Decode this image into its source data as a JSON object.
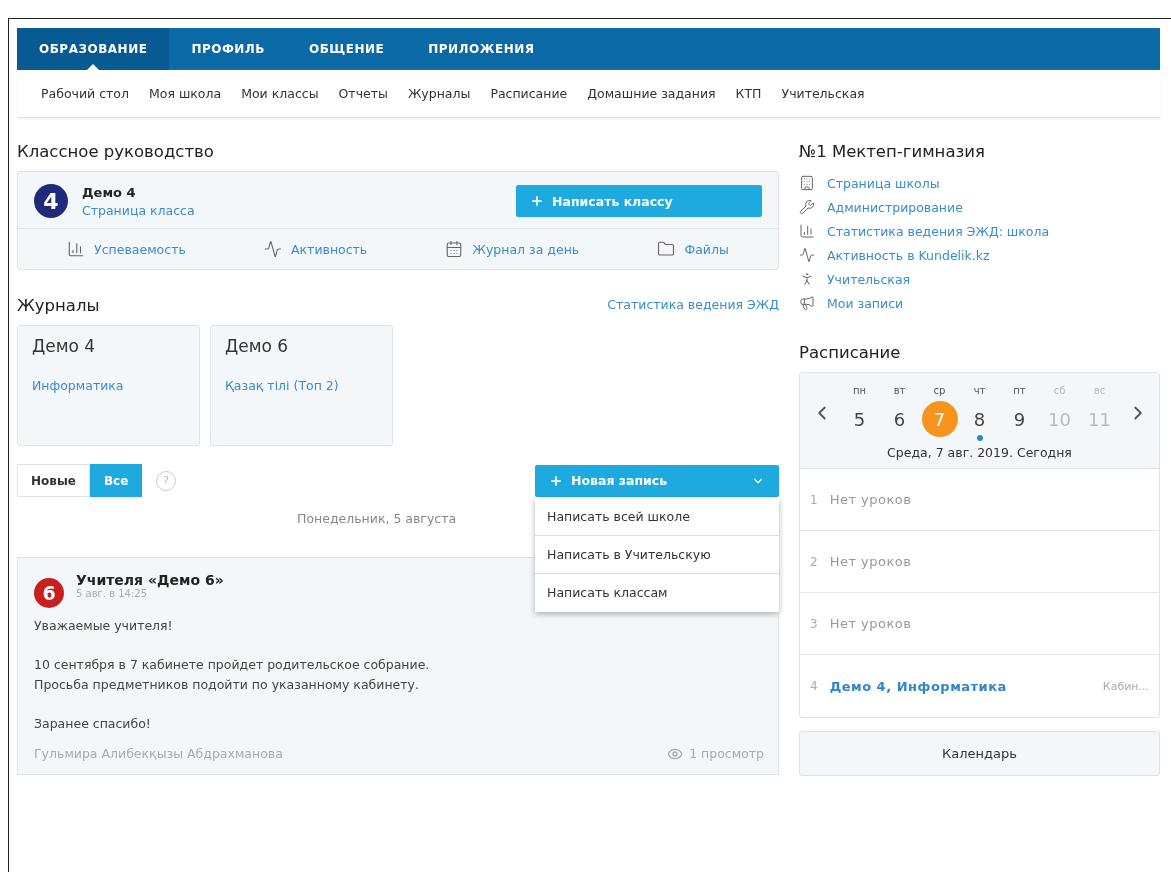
{
  "top_tabs": [
    {
      "label": "ОБРАЗОВАНИЕ",
      "selected": true
    },
    {
      "label": "ПРОФИЛЬ",
      "selected": false
    },
    {
      "label": "ОБЩЕНИЕ",
      "selected": false
    },
    {
      "label": "ПРИЛОЖЕНИЯ",
      "selected": false
    }
  ],
  "sub_nav": [
    "Рабочий стол",
    "Моя школа",
    "Мои классы",
    "Отчеты",
    "Журналы",
    "Расписание",
    "Домашние задания",
    "КТП",
    "Учительская"
  ],
  "class_management": {
    "title": "Классное руководство",
    "badge": "4",
    "class_name": "Демо 4",
    "class_link": "Страница класса",
    "write_button": "Написать классу",
    "links": [
      {
        "kind": "chart",
        "label": "Успеваемость"
      },
      {
        "kind": "pulse",
        "label": "Активность"
      },
      {
        "kind": "calendar",
        "label": "Журнал за день"
      },
      {
        "kind": "folder",
        "label": "Файлы"
      }
    ]
  },
  "journals": {
    "title": "Журналы",
    "stats_link": "Статистика ведения ЭЖД",
    "cards": [
      {
        "class": "Демо 4",
        "subject": "Информатика"
      },
      {
        "class": "Демо 6",
        "subject": "Қазақ тілі (Топ 2)"
      }
    ]
  },
  "feed": {
    "filters": [
      {
        "label": "Новые",
        "selected": false
      },
      {
        "label": "Все",
        "selected": true
      }
    ],
    "help": "?",
    "new_button": "Новая запись",
    "menu": [
      "Написать всей школе",
      "Написать в Учительскую",
      "Написать классам"
    ],
    "date": "Понедельник, 5 августа",
    "post": {
      "badge": "6",
      "title": "Учителя «Демо 6»",
      "time": "5 авг. в 14:25",
      "paragraphs": [
        "Уважаемые учителя!",
        "10 сентября в 7 кабинете пройдет родительское собрание.\nПросьба предметников подойти по указанному кабинету.",
        "Заранее спасибо!"
      ],
      "author": "Гульмира Алибекқызы Абдрахманова",
      "views": "1 просмотр"
    }
  },
  "school": {
    "title": "№1 Мектеп-гимназия",
    "links": [
      {
        "kind": "building",
        "label": "Страница школы"
      },
      {
        "kind": "wrench",
        "label": "Администрирование"
      },
      {
        "kind": "chart",
        "label": "Статистика ведения ЭЖД: школа"
      },
      {
        "kind": "pulse",
        "label": "Активность в Kundelik.kz"
      },
      {
        "kind": "person",
        "label": "Учительская"
      },
      {
        "kind": "megaphone",
        "label": "Мои записи"
      }
    ]
  },
  "schedule": {
    "title": "Расписание",
    "days": [
      {
        "weekday": "пн",
        "date": "5",
        "selected": false,
        "weekend": false,
        "has_event": false
      },
      {
        "weekday": "вт",
        "date": "6",
        "selected": false,
        "weekend": false,
        "has_event": false
      },
      {
        "weekday": "ср",
        "date": "7",
        "selected": true,
        "weekend": false,
        "has_event": false
      },
      {
        "weekday": "чт",
        "date": "8",
        "selected": false,
        "weekend": false,
        "has_event": true
      },
      {
        "weekday": "пт",
        "date": "9",
        "selected": false,
        "weekend": false,
        "has_event": false
      },
      {
        "weekday": "сб",
        "date": "10",
        "selected": false,
        "weekend": true,
        "has_event": false
      },
      {
        "weekday": "вс",
        "date": "11",
        "selected": false,
        "weekend": true,
        "has_event": false
      }
    ],
    "date_caption": "Среда, 7 авг. 2019. Сегодня",
    "lessons": [
      {
        "kind": "empty",
        "number": "1",
        "text": "Нет уроков"
      },
      {
        "kind": "empty",
        "number": "2",
        "text": "Нет уроков"
      },
      {
        "kind": "empty",
        "number": "3",
        "text": "Нет уроков"
      },
      {
        "kind": "lesson",
        "number": "4",
        "text": "Демо 4, Информатика",
        "room": "Кабин..."
      }
    ],
    "calendar_button": "Календарь"
  }
}
